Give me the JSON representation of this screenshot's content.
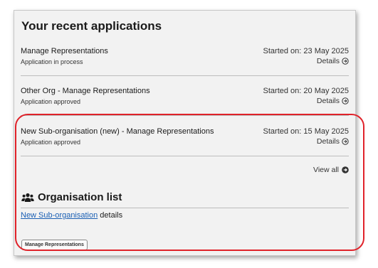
{
  "section_title": "Your recent applications",
  "applications": [
    {
      "name": "Manage Representations",
      "status": "Application in process",
      "started": "Started on: 23 May 2025",
      "details": "Details"
    },
    {
      "name": "Other Org - Manage Representations",
      "status": "Application approved",
      "started": "Started on: 20 May 2025",
      "details": "Details"
    },
    {
      "name": "New Sub-organisation (new) - Manage Representations",
      "status": "Application approved",
      "started": "Started on: 15 May 2025",
      "details": "Details"
    }
  ],
  "view_all": "View all",
  "org_list": {
    "title": "Organisation list",
    "link_text": "New Sub-organisation",
    "suffix": " details",
    "button": "Manage Representations"
  },
  "colors": {
    "highlight": "#e0222a",
    "link": "#1a5fb4",
    "panel": "#f2f2f2"
  },
  "icons": {
    "details": "circle-arrow-right-icon",
    "view_all": "filled-circle-arrow-icon",
    "org": "people-group-icon"
  }
}
